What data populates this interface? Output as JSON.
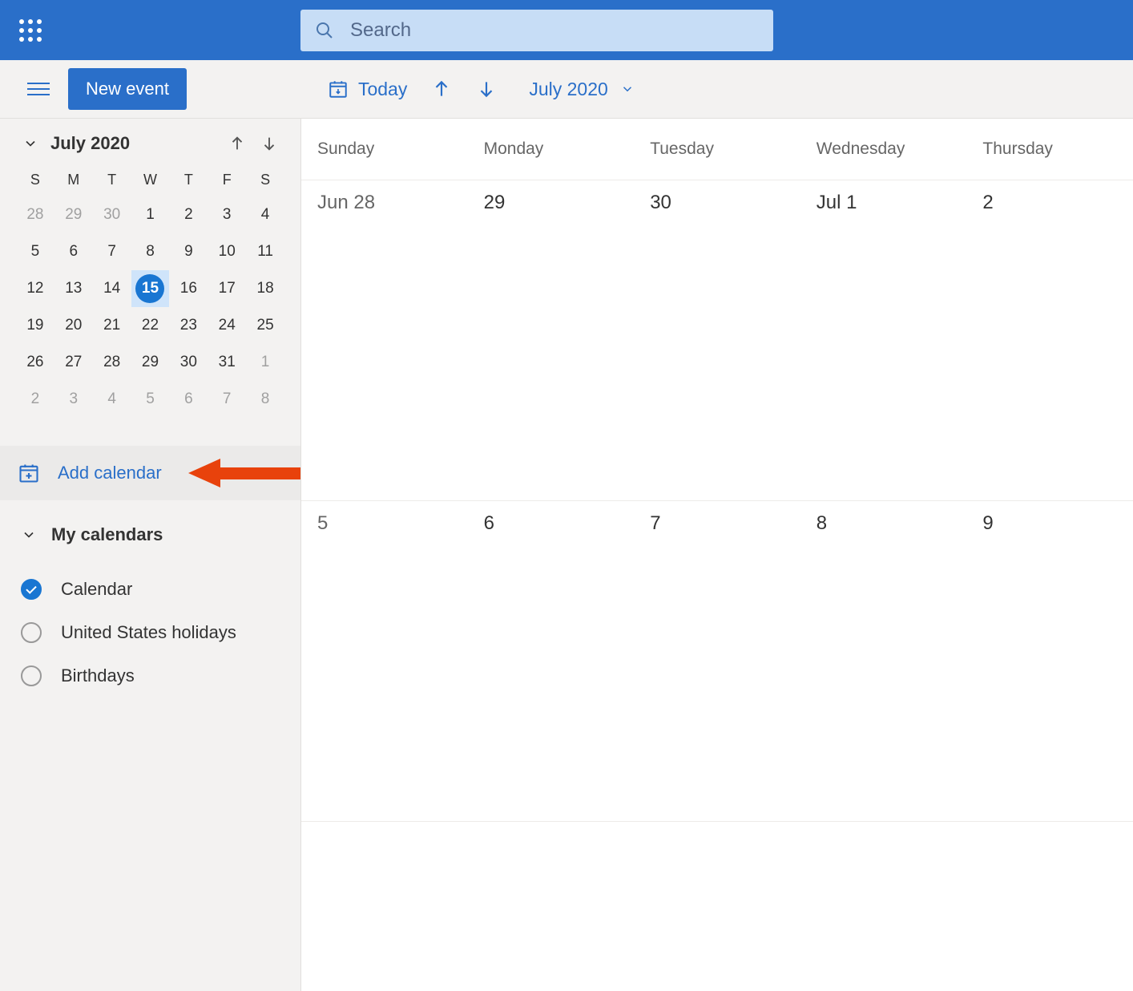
{
  "header": {
    "search_placeholder": "Search"
  },
  "subheader": {
    "new_event_label": "New event",
    "today_label": "Today",
    "date_label": "July 2020"
  },
  "mini_calendar": {
    "title": "July 2020",
    "dow": [
      "S",
      "M",
      "T",
      "W",
      "T",
      "F",
      "S"
    ],
    "weeks": [
      [
        {
          "d": "28",
          "o": true
        },
        {
          "d": "29",
          "o": true
        },
        {
          "d": "30",
          "o": true
        },
        {
          "d": "1"
        },
        {
          "d": "2"
        },
        {
          "d": "3"
        },
        {
          "d": "4"
        }
      ],
      [
        {
          "d": "5"
        },
        {
          "d": "6"
        },
        {
          "d": "7"
        },
        {
          "d": "8"
        },
        {
          "d": "9"
        },
        {
          "d": "10"
        },
        {
          "d": "11"
        }
      ],
      [
        {
          "d": "12"
        },
        {
          "d": "13"
        },
        {
          "d": "14"
        },
        {
          "d": "15",
          "sel": true
        },
        {
          "d": "16"
        },
        {
          "d": "17"
        },
        {
          "d": "18"
        }
      ],
      [
        {
          "d": "19"
        },
        {
          "d": "20"
        },
        {
          "d": "21"
        },
        {
          "d": "22"
        },
        {
          "d": "23"
        },
        {
          "d": "24"
        },
        {
          "d": "25"
        }
      ],
      [
        {
          "d": "26"
        },
        {
          "d": "27"
        },
        {
          "d": "28"
        },
        {
          "d": "29"
        },
        {
          "d": "30"
        },
        {
          "d": "31"
        },
        {
          "d": "1",
          "o": true
        }
      ],
      [
        {
          "d": "2",
          "o": true
        },
        {
          "d": "3",
          "o": true
        },
        {
          "d": "4",
          "o": true
        },
        {
          "d": "5",
          "o": true
        },
        {
          "d": "6",
          "o": true
        },
        {
          "d": "7",
          "o": true
        },
        {
          "d": "8",
          "o": true
        }
      ]
    ]
  },
  "add_calendar_label": "Add calendar",
  "my_calendars": {
    "title": "My calendars",
    "items": [
      {
        "label": "Calendar",
        "checked": true
      },
      {
        "label": "United States holidays",
        "checked": false
      },
      {
        "label": "Birthdays",
        "checked": false
      }
    ]
  },
  "grid": {
    "day_headers": [
      "Sunday",
      "Monday",
      "Tuesday",
      "Wednesday",
      "Thursday"
    ],
    "weeks": [
      [
        "Jun 28",
        "29",
        "30",
        "Jul 1",
        "2"
      ],
      [
        "5",
        "6",
        "7",
        "8",
        "9"
      ]
    ]
  }
}
